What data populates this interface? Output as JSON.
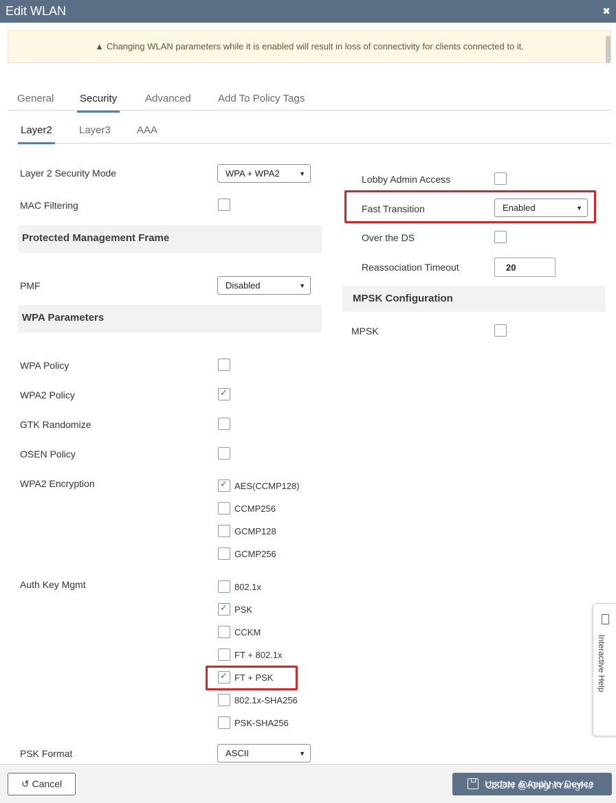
{
  "window": {
    "title": "Edit WLAN",
    "close_label": "✖"
  },
  "alert": {
    "icon": "warning-icon",
    "text": "Changing WLAN parameters while it is enabled will result in loss of connectivity for clients connected to it."
  },
  "tabs": [
    "General",
    "Security",
    "Advanced",
    "Add To Policy Tags"
  ],
  "active_tab": "Security",
  "subtabs": [
    "Layer2",
    "Layer3",
    "AAA"
  ],
  "active_subtab": "Layer2",
  "left": {
    "l2_mode": {
      "label": "Layer 2 Security Mode",
      "value": "WPA + WPA2"
    },
    "mac_filtering": {
      "label": "MAC Filtering",
      "checked": false
    },
    "pmf_section": "Protected Management Frame",
    "pmf": {
      "label": "PMF",
      "value": "Disabled"
    },
    "wpa_section": "WPA Parameters",
    "wpa_policy": {
      "label": "WPA Policy",
      "checked": false
    },
    "wpa2_policy": {
      "label": "WPA2 Policy",
      "checked": true
    },
    "gtk": {
      "label": "GTK Randomize",
      "checked": false
    },
    "osen": {
      "label": "OSEN Policy",
      "checked": false
    },
    "wpa2_enc": {
      "label": "WPA2 Encryption",
      "options": [
        {
          "text": "AES(CCMP128)",
          "checked": true
        },
        {
          "text": "CCMP256",
          "checked": false
        },
        {
          "text": "GCMP128",
          "checked": false
        },
        {
          "text": "GCMP256",
          "checked": false
        }
      ]
    },
    "akm": {
      "label": "Auth Key Mgmt",
      "options": [
        {
          "text": "802.1x",
          "checked": false
        },
        {
          "text": "PSK",
          "checked": true
        },
        {
          "text": "CCKM",
          "checked": false
        },
        {
          "text": "FT + 802.1x",
          "checked": false
        },
        {
          "text": "FT + PSK",
          "checked": true
        },
        {
          "text": "802.1x-SHA256",
          "checked": false
        },
        {
          "text": "PSK-SHA256",
          "checked": false
        }
      ]
    },
    "psk_format": {
      "label": "PSK Format",
      "value": "ASCII"
    }
  },
  "right": {
    "lobby": {
      "label": "Lobby Admin Access",
      "checked": false
    },
    "ft": {
      "label": "Fast Transition",
      "value": "Enabled"
    },
    "over_ds": {
      "label": "Over the DS",
      "checked": false
    },
    "reassoc": {
      "label": "Reassociation Timeout",
      "value": "20"
    },
    "mpsk_section": "MPSK Configuration",
    "mpsk": {
      "label": "MPSK",
      "checked": false
    }
  },
  "footer": {
    "cancel_label": "Cancel",
    "update_label": "Update & Apply to Device",
    "watermark": "CSDN @KnightYangHJ"
  },
  "help": {
    "label": "Interactive Help"
  },
  "colors": {
    "titlebar": "#5a6e86",
    "accent": "#3b87c9",
    "highlight": "#dd2222",
    "alert_bg": "#fcf8e3"
  }
}
